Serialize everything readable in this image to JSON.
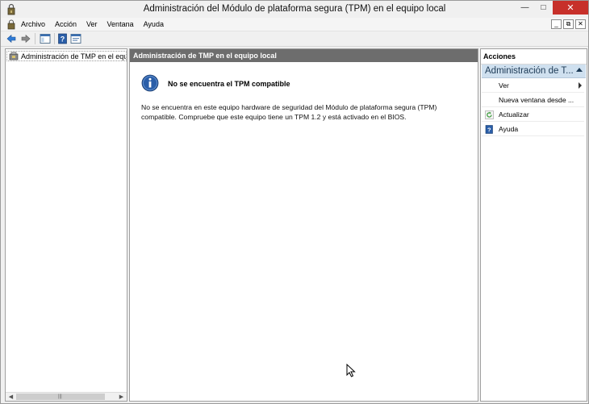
{
  "window": {
    "title": "Administración del Módulo de plataforma segura (TPM) en el equipo local",
    "controls": {
      "minimize": "—",
      "maximize": "□",
      "close": "✕"
    }
  },
  "menubar": {
    "items": [
      "Archivo",
      "Acción",
      "Ver",
      "Ventana",
      "Ayuda"
    ],
    "mdi_controls": [
      "_",
      "⧉",
      "✕"
    ]
  },
  "toolbar": {
    "icons": [
      "back-arrow-icon",
      "forward-arrow-icon",
      "show-hide-tree-icon",
      "help-icon",
      "properties-icon"
    ]
  },
  "tree": {
    "root_label": "Administración de TMP en el equipo local"
  },
  "main": {
    "header": "Administración de TMP en el equipo local",
    "heading": "No se encuentra el TPM compatible",
    "body": "No se encuentra en este equipo hardware de seguridad del Módulo de plataforma segura (TPM) compatible. Compruebe que este equipo tiene un TPM 1.2 y está activado en el BIOS."
  },
  "actions": {
    "title": "Acciones",
    "section": "Administración de T...",
    "items": [
      {
        "label": "Ver",
        "icon": "",
        "submenu": true
      },
      {
        "label": "Nueva ventana desde ...",
        "icon": "",
        "submenu": false
      },
      {
        "label": "Actualizar",
        "icon": "refresh-icon",
        "submenu": false
      },
      {
        "label": "Ayuda",
        "icon": "help-icon",
        "submenu": false
      }
    ]
  },
  "colors": {
    "close_button": "#c7302a",
    "pane_header": "#6d6d6d",
    "actions_section": "#cfe0ef",
    "info_icon": "#2a5ea8"
  }
}
